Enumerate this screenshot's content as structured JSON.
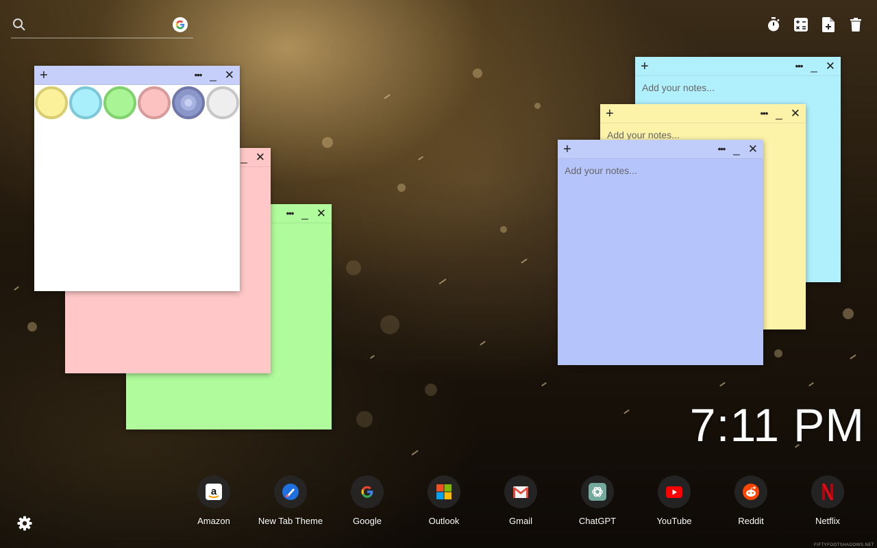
{
  "search": {
    "placeholder": "",
    "engine_icon": "google-icon"
  },
  "toolbar": {
    "icons": [
      "timer-icon",
      "calculator-icon",
      "new-note-icon",
      "trash-icon"
    ]
  },
  "notes": {
    "placeholder": "Add your notes...",
    "add_symbol": "+",
    "menu_symbol": "•••",
    "minimize_symbol": "_",
    "close_symbol": "✕",
    "colors": {
      "white": "#ffffff",
      "pink": "#ffc7c7",
      "green": "#b0fb9c",
      "cyan": "#b0f0fc",
      "yellow": "#fcf3a8",
      "blue": "#b5c4fb",
      "blue_bar": "#c5cffa"
    }
  },
  "palette": {
    "swatches": [
      {
        "name": "yellow",
        "fill": "#fbf19a",
        "ring": "#d9cd72"
      },
      {
        "name": "cyan",
        "fill": "#a8eefb",
        "ring": "#7cc8d8"
      },
      {
        "name": "green",
        "fill": "#a9f596",
        "ring": "#7fd26c"
      },
      {
        "name": "pink",
        "fill": "#fcc2c2",
        "ring": "#d99a9a"
      },
      {
        "name": "blue",
        "fill": "#8c97c9",
        "ring": "#6f78a8"
      },
      {
        "name": "gray",
        "fill": "#eeeeee",
        "ring": "#c7c7c7"
      }
    ]
  },
  "clock": {
    "time": "7:11 PM"
  },
  "dock": {
    "apps": [
      {
        "label": "Amazon",
        "icon": "amazon-icon"
      },
      {
        "label": "New Tab Theme",
        "icon": "new-tab-theme-icon"
      },
      {
        "label": "Google",
        "icon": "google-icon"
      },
      {
        "label": "Outlook",
        "icon": "outlook-icon"
      },
      {
        "label": "Gmail",
        "icon": "gmail-icon"
      },
      {
        "label": "ChatGPT",
        "icon": "chatgpt-icon"
      },
      {
        "label": "YouTube",
        "icon": "youtube-icon"
      },
      {
        "label": "Reddit",
        "icon": "reddit-icon"
      },
      {
        "label": "Netflix",
        "icon": "netflix-icon"
      }
    ]
  },
  "settings": {
    "icon": "gear-icon"
  },
  "credit": {
    "text": "FIFTYFOOTSHADOWS.NET"
  }
}
